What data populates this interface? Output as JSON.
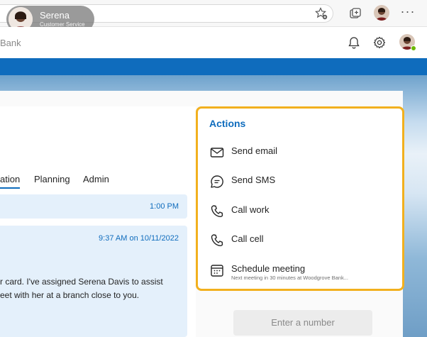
{
  "profile": {
    "name": "Serena",
    "role": "Customer Service"
  },
  "app": {
    "title": "Bank"
  },
  "tabs": [
    {
      "label": "ation"
    },
    {
      "label": "Planning"
    },
    {
      "label": "Admin"
    }
  ],
  "messages": [
    {
      "time": "1:00 PM"
    },
    {
      "time": "9:37 AM on 10/11/2022",
      "line1": "r card. I've assigned Serena Davis to assist",
      "line2": "eet with her at a branch close to you."
    }
  ],
  "actions": {
    "title": "Actions",
    "items": [
      {
        "label": "Send email",
        "icon": "mail-icon"
      },
      {
        "label": "Send SMS",
        "icon": "chat-icon"
      },
      {
        "label": "Call work",
        "icon": "phone-icon"
      },
      {
        "label": "Call cell",
        "icon": "phone-icon"
      },
      {
        "label": "Schedule meeting",
        "sub": "Next meeting in 30 minutes at Woodgrove Bank...",
        "icon": "calendar-icon"
      }
    ]
  },
  "dialer": {
    "placeholder": "Enter a number"
  },
  "colors": {
    "accent": "#0f6cbd",
    "highlight": "#f2b01e",
    "presence": "#6bb700"
  }
}
